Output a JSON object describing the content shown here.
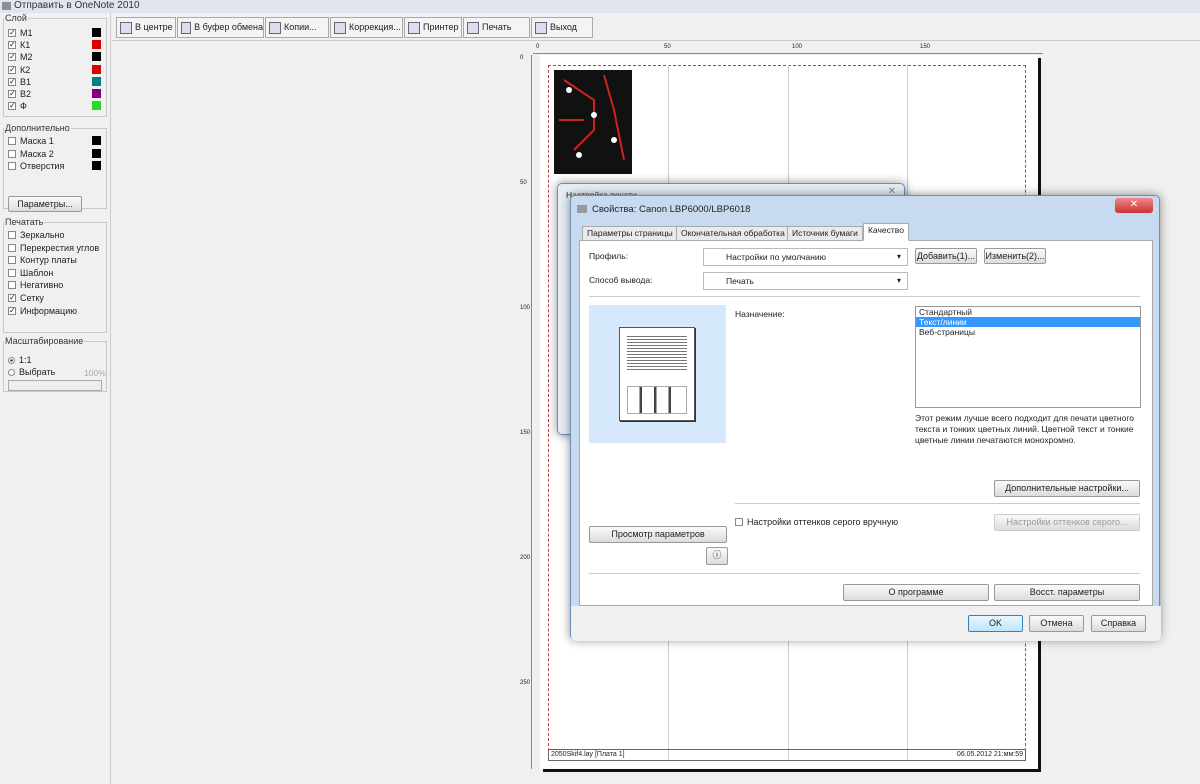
{
  "window": {
    "title": "Отправить в OneNote 2010"
  },
  "layers": {
    "legend": "Слой",
    "items": [
      {
        "label": "М1",
        "checked": true,
        "color": "#000000"
      },
      {
        "label": "К1",
        "checked": true,
        "color": "#dd0000"
      },
      {
        "label": "М2",
        "checked": true,
        "color": "#000000"
      },
      {
        "label": "К2",
        "checked": true,
        "color": "#dd0000"
      },
      {
        "label": "В1",
        "checked": true,
        "color": "#008080"
      },
      {
        "label": "В2",
        "checked": true,
        "color": "#800080"
      },
      {
        "label": "Ф",
        "checked": true,
        "color": "#22dd22"
      }
    ]
  },
  "extra": {
    "legend": "Дополнительно",
    "items": [
      {
        "label": "Маска 1",
        "checked": false,
        "color": "#000000"
      },
      {
        "label": "Маска 2",
        "checked": false,
        "color": "#000000"
      },
      {
        "label": "Отверстия",
        "checked": false,
        "color": "#000000"
      }
    ],
    "params_button": "Параметры..."
  },
  "print": {
    "legend": "Печатать",
    "items": [
      {
        "label": "Зеркально",
        "checked": false
      },
      {
        "label": "Перекрестия углов",
        "checked": false
      },
      {
        "label": "Контур платы",
        "checked": false
      },
      {
        "label": "Шаблон",
        "checked": false
      },
      {
        "label": "Негативно",
        "checked": false
      },
      {
        "label": "Сетку",
        "checked": true
      },
      {
        "label": "Информацию",
        "checked": true
      }
    ]
  },
  "scale": {
    "legend": "Масштабирование",
    "opt1": "1:1",
    "opt2": "Выбрать",
    "value": "100%"
  },
  "toolbar": [
    "В центре",
    "В буфер обмена",
    "Копии...",
    "Коррекция...",
    "Принтер",
    "Печать",
    "Выход"
  ],
  "rulers": {
    "top": [
      "0",
      "50",
      "100",
      "150"
    ],
    "left": [
      "0",
      "50",
      "100",
      "150",
      "200",
      "250"
    ]
  },
  "page_footer": {
    "left": "2050Skif4.lay [Плата 1]",
    "right": "06.05.2012 21:мм:59"
  },
  "back_dialog": {
    "title": "Настройка печати"
  },
  "dialog": {
    "title": "Свойства: Canon LBP6000/LBP6018",
    "tabs": [
      "Параметры страницы",
      "Окончательная обработка",
      "Источник бумаги",
      "Качество"
    ],
    "profile_label": "Профиль:",
    "profile_value": "Настройки по умолчанию",
    "add_button": "Добавить(1)...",
    "edit_button": "Изменить(2)...",
    "output_label": "Способ вывода:",
    "output_value": "Печать",
    "purpose_label": "Назначение:",
    "purpose_options": [
      "Стандартный",
      "Текст/линии",
      "Веб-страницы"
    ],
    "description": "Этот режим лучше всего подходит для печати цветного текста и тонких цветных линий. Цветной текст и тонкие цветные линии печатаются монохромно.",
    "advanced_button": "Дополнительные настройки...",
    "grayscale_checkbox": "Настройки оттенков серого вручную",
    "grayscale_button": "Настройки оттенков серого...",
    "preview_button": "Просмотр параметров",
    "about_button": "О программе",
    "restore_button": "Восст. параметры",
    "ok": "OK",
    "cancel": "Отмена",
    "help": "Справка"
  }
}
